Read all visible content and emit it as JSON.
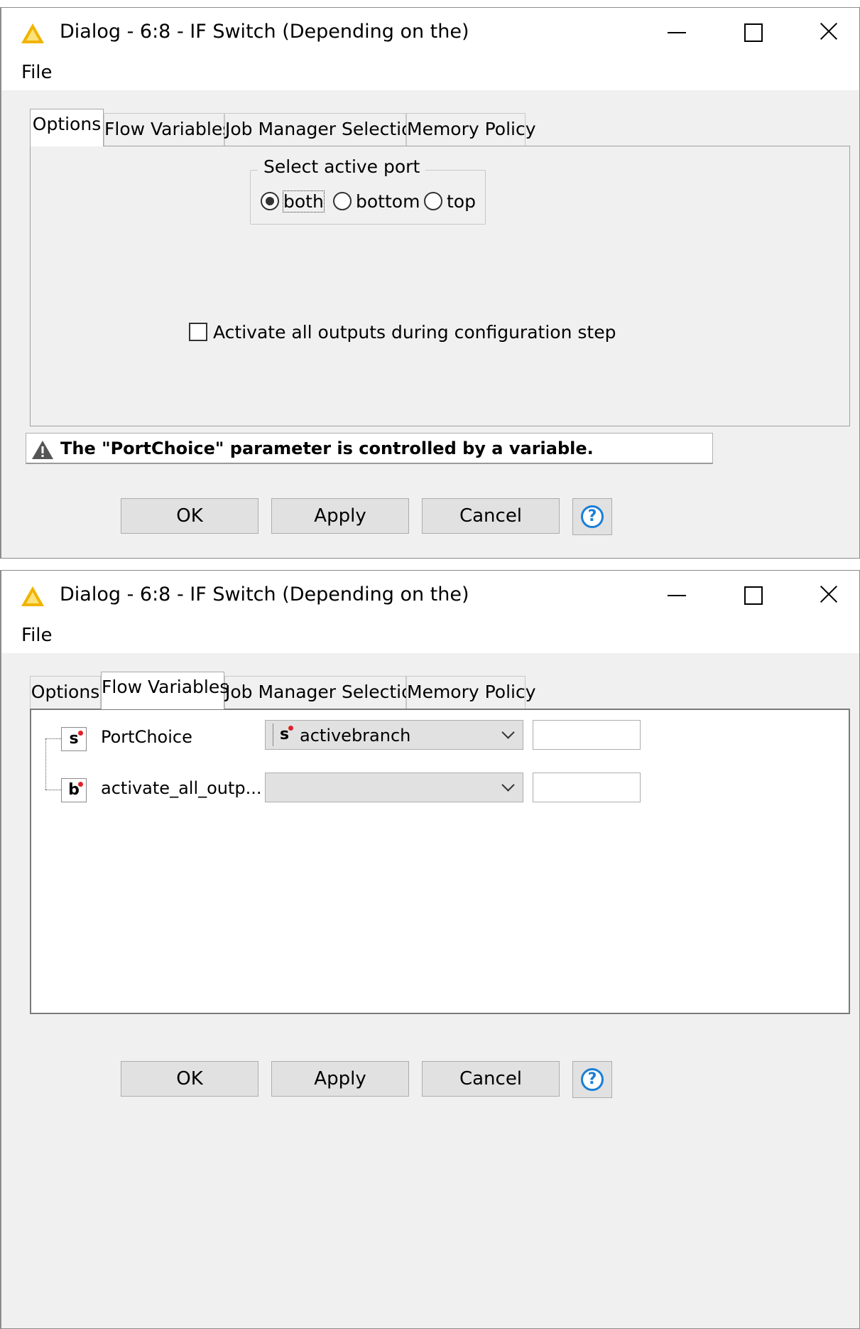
{
  "colors": {
    "window_bg": "#f0f0f0",
    "accent_blue": "#1a7fd6",
    "warning_yellow": "#f0b400",
    "badge_dot_red": "#e0202a"
  },
  "dialogs": [
    {
      "title": "Dialog - 6:8 - IF Switch (Depending on the)",
      "icon": "knime-warning-triangle-icon",
      "menu": {
        "file": "File"
      },
      "tabs": [
        "Options",
        "Flow Variables",
        "Job Manager Selection",
        "Memory Policy"
      ],
      "active_tab": "Options",
      "options": {
        "group_title": "Select active port",
        "radios": [
          "both",
          "bottom",
          "top"
        ],
        "selected": "both",
        "checkbox_label": "Activate all outputs during configuration step",
        "checkbox_checked": false
      },
      "warning": "The \"PortChoice\" parameter is controlled by a variable.",
      "buttons": {
        "ok": "OK",
        "apply": "Apply",
        "cancel": "Cancel",
        "help": "?"
      }
    },
    {
      "title": "Dialog - 6:8 - IF Switch (Depending on the)",
      "icon": "knime-warning-triangle-icon",
      "menu": {
        "file": "File"
      },
      "tabs": [
        "Options",
        "Flow Variables",
        "Job Manager Selection",
        "Memory Policy"
      ],
      "active_tab": "Flow Variables",
      "flow_variables": [
        {
          "type_badge": "s",
          "name": "PortChoice",
          "selected_variable": "activebranch",
          "selected_badge": "s",
          "text_value": ""
        },
        {
          "type_badge": "b",
          "name": "activate_all_outp...",
          "selected_variable": "",
          "selected_badge": "",
          "text_value": ""
        }
      ],
      "buttons": {
        "ok": "OK",
        "apply": "Apply",
        "cancel": "Cancel",
        "help": "?"
      }
    }
  ]
}
